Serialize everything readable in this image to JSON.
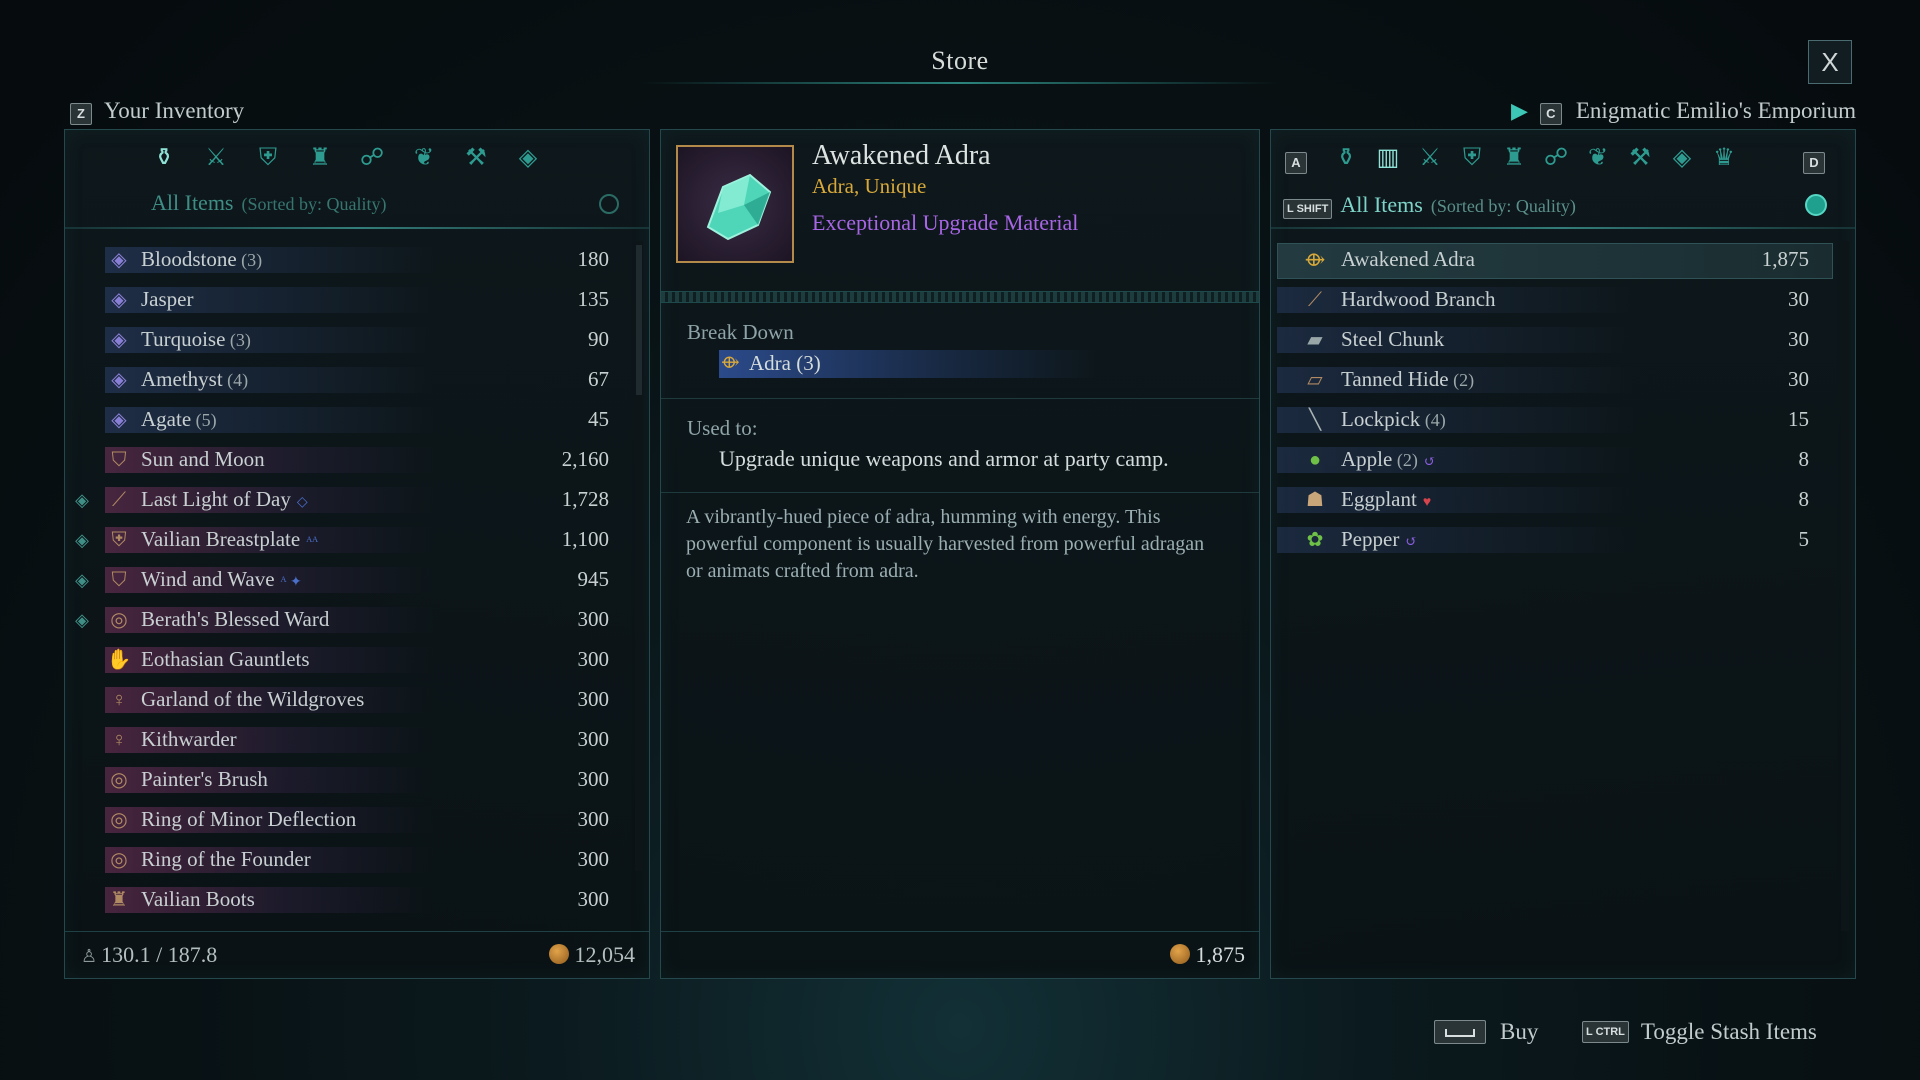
{
  "window": {
    "title": "Store",
    "close_label": "X"
  },
  "inventory_header": {
    "key": "Z",
    "label": "Your Inventory"
  },
  "store_header": {
    "key": "C",
    "label": "Enigmatic Emilio's Emporium"
  },
  "inventory": {
    "categories": [
      "bag-icon",
      "weapons-icon",
      "armor-icon",
      "boots-icon",
      "accessories-icon",
      "consumables-icon",
      "anvil-icon",
      "gem-icon"
    ],
    "filter_label": "All Items",
    "sort_label": "(Sorted by: Quality)",
    "items": [
      {
        "name": "Bloodstone",
        "count": "(3)",
        "value": "180",
        "icon": "gem-icon",
        "equipped": false,
        "badge": ""
      },
      {
        "name": "Jasper",
        "count": "",
        "value": "135",
        "icon": "gem-icon",
        "equipped": false,
        "badge": ""
      },
      {
        "name": "Turquoise",
        "count": "(3)",
        "value": "90",
        "icon": "gem-icon",
        "equipped": false,
        "badge": ""
      },
      {
        "name": "Amethyst",
        "count": "(4)",
        "value": "67",
        "icon": "gem-icon",
        "equipped": false,
        "badge": ""
      },
      {
        "name": "Agate",
        "count": "(5)",
        "value": "45",
        "icon": "gem-icon",
        "equipped": false,
        "badge": ""
      },
      {
        "name": "Sun and Moon",
        "count": "",
        "value": "2,160",
        "icon": "shield-icon",
        "equipped": false,
        "badge": ""
      },
      {
        "name": "Last Light of Day",
        "count": "",
        "value": "1,728",
        "icon": "sword-icon",
        "equipped": true,
        "badge": "◇"
      },
      {
        "name": "Vailian Breastplate",
        "count": "",
        "value": "1,100",
        "icon": "armor-icon",
        "equipped": true,
        "badge": "ᴬᴬ"
      },
      {
        "name": "Wind and Wave",
        "count": "",
        "value": "945",
        "icon": "shield-icon",
        "equipped": true,
        "badge": "ᴬ ✦"
      },
      {
        "name": "Berath's Blessed Ward",
        "count": "",
        "value": "300",
        "icon": "ring-icon",
        "equipped": true,
        "badge": ""
      },
      {
        "name": "Eothasian Gauntlets",
        "count": "",
        "value": "300",
        "icon": "gauntlet-icon",
        "equipped": false,
        "badge": ""
      },
      {
        "name": "Garland of the Wildgroves",
        "count": "",
        "value": "300",
        "icon": "amulet-icon",
        "equipped": false,
        "badge": ""
      },
      {
        "name": "Kithwarder",
        "count": "",
        "value": "300",
        "icon": "amulet-icon",
        "equipped": false,
        "badge": ""
      },
      {
        "name": "Painter's Brush",
        "count": "",
        "value": "300",
        "icon": "ring-icon",
        "equipped": false,
        "badge": ""
      },
      {
        "name": "Ring of Minor Deflection",
        "count": "",
        "value": "300",
        "icon": "ring-icon",
        "equipped": false,
        "badge": ""
      },
      {
        "name": "Ring of the Founder",
        "count": "",
        "value": "300",
        "icon": "ring-icon",
        "equipped": false,
        "badge": ""
      },
      {
        "name": "Vailian Boots",
        "count": "",
        "value": "300",
        "icon": "boots-icon",
        "equipped": false,
        "badge": ""
      }
    ],
    "weight": "130.1 / 187.8",
    "gold": "12,054"
  },
  "detail": {
    "name": "Awakened Adra",
    "subtitle": "Adra, Unique",
    "type": "Exceptional Upgrade Material",
    "break_down_label": "Break Down",
    "break_down_item": "Adra (3)",
    "used_to_label": "Used to:",
    "used_to_text": "Upgrade unique weapons and armor at party camp.",
    "description": "A vibrantly-hued piece of adra, humming with energy. This powerful component is usually harvested from powerful adragan or animats crafted from adra.",
    "price": "1,875"
  },
  "store": {
    "key_left": "A",
    "key_right": "D",
    "shift_key": "L SHIFT",
    "filter_label": "All Items",
    "sort_label": "(Sorted by: Quality)",
    "items": [
      {
        "name": "Awakened Adra",
        "count": "",
        "value": "1,875",
        "icon": "adra-icon",
        "badge": ""
      },
      {
        "name": "Hardwood Branch",
        "count": "",
        "value": "30",
        "icon": "branch-icon",
        "badge": ""
      },
      {
        "name": "Steel Chunk",
        "count": "",
        "value": "30",
        "icon": "ingot-icon",
        "badge": ""
      },
      {
        "name": "Tanned Hide",
        "count": "(2)",
        "value": "30",
        "icon": "hide-icon",
        "badge": ""
      },
      {
        "name": "Lockpick",
        "count": "(4)",
        "value": "15",
        "icon": "lockpick-icon",
        "badge": ""
      },
      {
        "name": "Apple",
        "count": "(2)",
        "value": "8",
        "icon": "apple-icon",
        "badge": "↺"
      },
      {
        "name": "Eggplant",
        "count": "",
        "value": "8",
        "icon": "eggplant-icon",
        "badge": "♥"
      },
      {
        "name": "Pepper",
        "count": "",
        "value": "5",
        "icon": "pepper-icon",
        "badge": "↺"
      }
    ]
  },
  "actions": {
    "buy_label": "Buy",
    "toggle_key": "L CTRL",
    "toggle_label": "Toggle Stash Items"
  },
  "colors": {
    "accent_teal": "#2e9b90",
    "detail_gold": "#d8a93a",
    "detail_purple": "#a865e6",
    "unique_row_purple": "#5c2b4c",
    "row_blue": "#283a5e"
  }
}
